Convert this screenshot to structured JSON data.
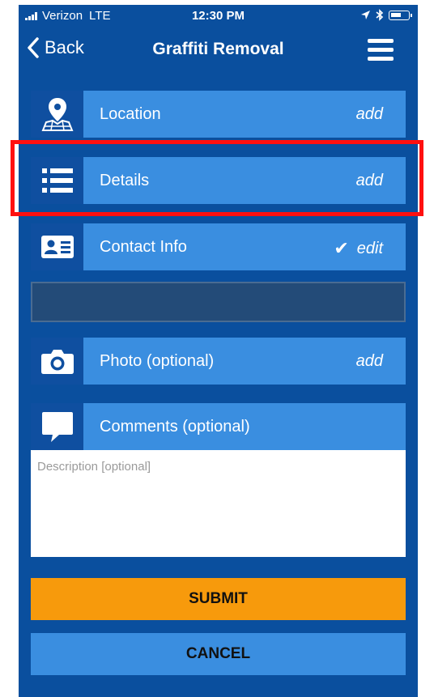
{
  "status_bar": {
    "carrier": "Verizon",
    "network": "LTE",
    "time": "12:30 PM"
  },
  "nav": {
    "back_label": "Back",
    "title": "Graffiti Removal"
  },
  "rows": {
    "location": {
      "label": "Location",
      "action": "add",
      "icon": "map-pin-icon"
    },
    "details": {
      "label": "Details",
      "action": "add",
      "icon": "list-icon"
    },
    "contact": {
      "label": "Contact Info",
      "action": "edit",
      "status": "✔",
      "icon": "contact-card-icon"
    },
    "photo": {
      "label": "Photo (optional)",
      "action": "add",
      "icon": "camera-icon"
    },
    "comments": {
      "label": "Comments (optional)",
      "icon": "speech-bubble-icon"
    }
  },
  "description": {
    "placeholder": "Description [optional]"
  },
  "buttons": {
    "submit": "SUBMIT",
    "cancel": "CANCEL"
  },
  "colors": {
    "background": "#0a4f9e",
    "row": "#3a8ee0",
    "icon_box": "#0f4fa0",
    "submit": "#f79a0c",
    "highlight": "#ff1010"
  }
}
